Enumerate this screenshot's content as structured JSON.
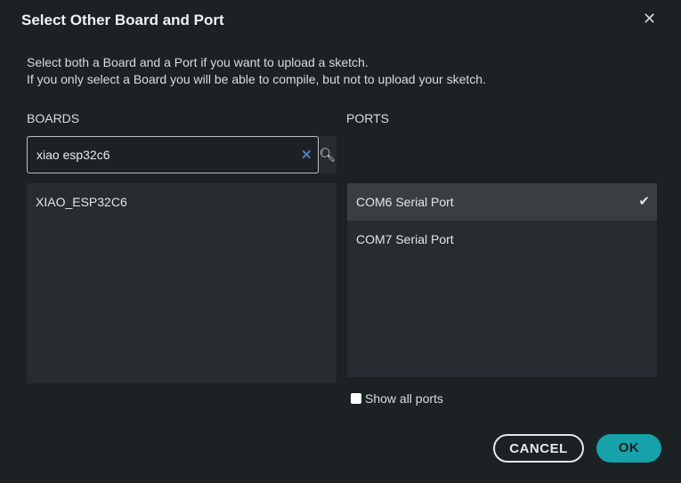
{
  "dialog": {
    "title": "Select Other Board and Port",
    "close_icon": "close-icon"
  },
  "description": [
    "Select both a Board and a Port if you want to upload a sketch.",
    "If you only select a Board you will be able to compile, but not to upload your sketch."
  ],
  "boards": {
    "label": "BOARDS",
    "search_value": "xiao esp32c6",
    "clear_glyph": "✕",
    "search_glyph": "🔍︎",
    "items": [
      "XIAO_ESP32C6"
    ]
  },
  "ports": {
    "label": "PORTS",
    "items": [
      {
        "label": "COM6 Serial Port",
        "selected": true
      },
      {
        "label": "COM7 Serial Port",
        "selected": false
      }
    ],
    "check_glyph": "✔",
    "show_all_label": "Show all ports",
    "show_all_checked": false
  },
  "buttons": {
    "cancel": "CANCEL",
    "ok": "OK"
  },
  "colors": {
    "accent": "#17a1a8",
    "background": "#1c2124",
    "panel": "#262c30"
  }
}
